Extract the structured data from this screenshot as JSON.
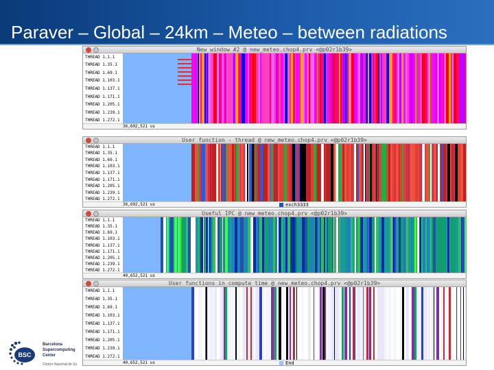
{
  "slide": {
    "title": "Paraver – Global – 24km – Meteo – between radiations"
  },
  "colors": {
    "header_dark": "#0a3a78",
    "header_light": "#2a6fbe",
    "idle_blue": "#7fb6ff"
  },
  "windows": [
    {
      "title": "New window #2 @ new_meteo.chop4.prv <@p02r1b39>",
      "threads": [
        "THREAD 1.1.1",
        "THREAD 1.35.1",
        "THREAD 1.69.1",
        "THREAD 1.103.1",
        "THREAD 1.137.1",
        "THREAD 1.171.1",
        "THREAD 1.205.1",
        "THREAD 1.239.1",
        "THREAD 1.272.1"
      ],
      "footer_time": "36,692,521 us",
      "legend": "",
      "palette": [
        "#ff00ff",
        "#e020e0",
        "#ff40c0",
        "#c000ff",
        "#ff0080",
        "#ff66ff"
      ],
      "accent": [
        "#ff0000",
        "#0000ff",
        "#ffa000"
      ],
      "idle_fraction": 0.2
    },
    {
      "title": "User function - thread @ new_meteo.chop4.prv <@p02r1b39>",
      "threads": [
        "THREAD 1.1.1",
        "THREAD 1.35.1",
        "THREAD 1.69.1",
        "THREAD 1.103.1",
        "THREAD 1.137.1",
        "THREAD 1.171.1",
        "THREAD 1.205.1",
        "THREAD 1.239.1",
        "THREAD 1.272.1"
      ],
      "footer_time": "36,692,521 us",
      "legend": "exch3333",
      "legend_color": "#2050d0",
      "palette": [
        "#e04030",
        "#d03050",
        "#c02020",
        "#f05040",
        "#b02838"
      ],
      "accent": [
        "#2060e0",
        "#20b040",
        "#ffffff",
        "#000000"
      ],
      "idle_fraction": 0.2
    },
    {
      "title": "Useful IPC @ new_meteo.chop4.prv <@p02r1b39>",
      "threads": [
        "THREAD 1.1.1",
        "THREAD 1.35.1",
        "THREAD 1.69.1",
        "THREAD 1.103.1",
        "THREAD 1.137.1",
        "THREAD 1.171.1",
        "THREAD 1.205.1",
        "THREAD 1.239.1",
        "THREAD 1.272.1"
      ],
      "footer_time": "40,652,521 us",
      "legend": "",
      "palette": [
        "#2080c0",
        "#10a070",
        "#30c060",
        "#2050b0",
        "#1a9aa0"
      ],
      "accent": [
        "#40ff40",
        "#0030a0",
        "#ffffff"
      ],
      "idle_fraction": 0.11
    },
    {
      "title": "User functions in compute time @ new_meteo.chop4.prv <@p02r1b39>",
      "threads": [
        "THREAD 1.1.1",
        "THREAD 1.35.1",
        "THREAD 1.69.1",
        "THREAD 1.103.1",
        "THREAD 1.137.1",
        "THREAD 1.171.1",
        "THREAD 1.205.1",
        "THREAD 1.239.1",
        "THREAD 1.272.1"
      ],
      "footer_time": "40,652,521 us",
      "legend": "End",
      "legend_color": "#a0c0ff",
      "palette": [
        "#ffffff",
        "#f4f4ff",
        "#e8e8f8"
      ],
      "accent": [
        "#3040c0",
        "#c03030",
        "#20a060",
        "#8030a0",
        "#000000"
      ],
      "idle_fraction": 0.2
    }
  ],
  "logo": {
    "lines": [
      "Barcelona",
      "Supercomputing",
      "Center"
    ],
    "sub": "Centro Nacional de Su"
  }
}
